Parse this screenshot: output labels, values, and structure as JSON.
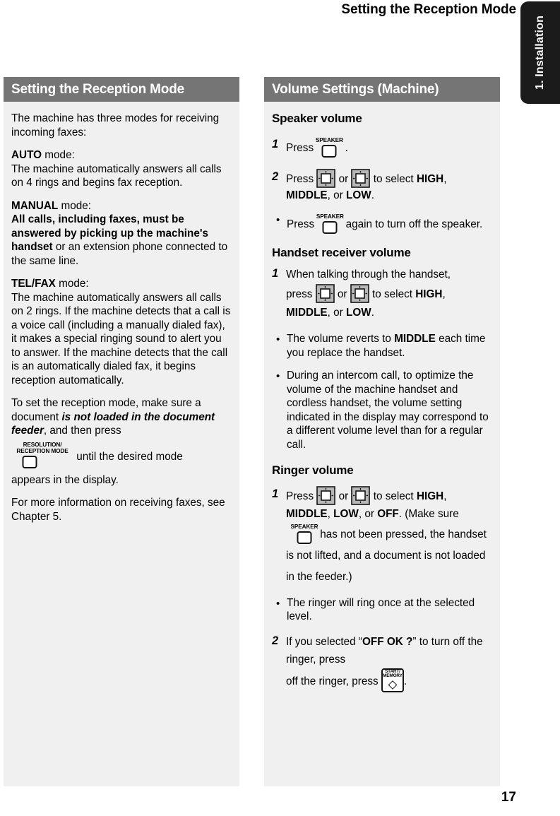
{
  "header": {
    "running_title": "Setting the Reception Mode"
  },
  "side_tab": {
    "label": "1. Installation"
  },
  "page": {
    "number": "17"
  },
  "colors": {
    "section_header_bg": "#757575",
    "panel_bg": "#f0f0f0",
    "tab_bg": "#1b1b1b",
    "key_fill": "#b8b8b8",
    "text": "#000000"
  },
  "left_column": {
    "section_title": "Setting the Reception Mode",
    "p_intro": "The machine has three modes for receiving incoming faxes:",
    "auto": {
      "mode_label": "AUTO",
      "mode_suffix": " mode:",
      "body": "The machine automatically answers all calls on 4 rings and begins fax reception."
    },
    "manual": {
      "mode_label": "MANUAL",
      "mode_suffix": " mode:",
      "body_bold": "All calls, including faxes, must be answered by picking up the machine's handset",
      "body_rest": " or an extension phone connected to the same line."
    },
    "telfax": {
      "mode_label": "TEL/FAX",
      "mode_suffix": " mode:",
      "body": "The machine automatically answers all calls on 2 rings. If the machine detects that a call is a voice call (including a manually dialed fax), it makes a special ringing sound to alert you to answer. If the machine detects that the call is an automatically dialed fax, it begins reception automatically."
    },
    "set_mode": {
      "lead": "To set the reception mode, make sure a document ",
      "emph": "is not loaded in the document feeder",
      "tail": ", and then press",
      "key_caption_line1": "RESOLUTION/",
      "key_caption_line2": "RECEPTION MODE",
      "after_key": " until the desired mode",
      "final_line": "appears in the display."
    },
    "p_more_info": "For more information on receiving faxes, see Chapter 5."
  },
  "right_column": {
    "section_title": "Volume Settings (Machine)",
    "speaker_volume": {
      "heading": "Speaker volume",
      "step1": {
        "num": "1",
        "pre": "Press",
        "key_caption": "SPEAKER",
        "post": "."
      },
      "step2": {
        "num": "2",
        "pre": "Press",
        "mid": "or",
        "post": "to select ",
        "opt1": "HIGH",
        "sep1": ", ",
        "opt2": "MIDDLE",
        "sep2": ", or ",
        "opt3": "LOW",
        "end": "."
      },
      "bullet1": {
        "pre": "Press",
        "key_caption": "SPEAKER",
        "post": "again to turn off the speaker."
      }
    },
    "handset_volume": {
      "heading": "Handset receiver volume",
      "step1": {
        "num": "1",
        "line1": "When talking through the handset,",
        "pre": "press",
        "mid": "or",
        "post": "to select ",
        "opt1": "HIGH",
        "sep1": ", ",
        "opt2": "MIDDLE",
        "sep2": ", or ",
        "opt3": "LOW",
        "end": "."
      },
      "bullet1": {
        "pre": "The volume reverts to ",
        "bold": "MIDDLE",
        "post": " each time you replace the handset."
      },
      "bullet2": {
        "text": "During an intercom call, to optimize the volume of the machine handset and cordless handset, the volume setting indicated in the display may correspond to a different volume level than for a regular call."
      }
    },
    "ringer_volume": {
      "heading": "Ringer volume",
      "step1": {
        "num": "1",
        "pre": "Press",
        "mid": "or",
        "post": "to select ",
        "opt1": "HIGH",
        "sep1": ", ",
        "opt2": "MIDDLE",
        "sep2": ", ",
        "opt3": "LOW",
        "sep3": ", or ",
        "opt4": "OFF",
        "after_opts": ". (Make sure",
        "key_caption": "SPEAKER",
        "tail": " has not been pressed, the handset is not lifted, and a document is not loaded in the feeder.)"
      },
      "bullet1": {
        "text": "The ringer will ring once at the selected level."
      },
      "step2": {
        "num": "2",
        "pre": "If you selected “",
        "bold": "OFF OK ?",
        "mid": "” to turn off the ringer, press",
        "key_caption_line1": "START/",
        "key_caption_line2": "MEMORY",
        "end": "."
      }
    }
  },
  "icons": {
    "volume_up_key": "arrow-key-icon",
    "volume_down_key": "arrow-key-icon",
    "speaker_key": "speaker-button-icon",
    "reception_mode_key": "reception-mode-button-icon",
    "start_memory_key": "start-memory-button-icon"
  }
}
